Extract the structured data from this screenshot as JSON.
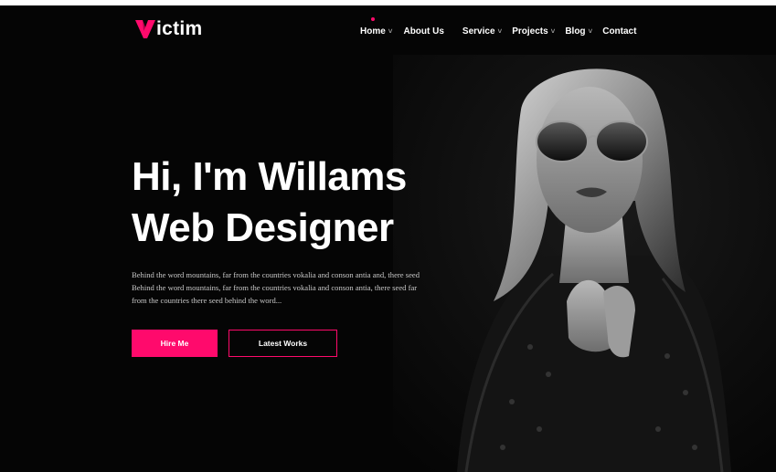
{
  "brand": {
    "logo_text": "ictim",
    "accent_color": "#ff0a6c"
  },
  "nav": {
    "items": [
      {
        "label": "Home",
        "caret": "˅"
      },
      {
        "label": "About Us",
        "caret": ""
      },
      {
        "label": "Service",
        "caret": "˅"
      },
      {
        "label": "Projects",
        "caret": "˅"
      },
      {
        "label": "Blog",
        "caret": "˅"
      },
      {
        "label": "Contact",
        "caret": ""
      }
    ]
  },
  "hero": {
    "title_line1": "Hi, I'm Willams",
    "title_line2": "Web Designer",
    "description": "Behind the word mountains, far from the countries vokalia and conson antia and, there seed Behind the word mountains, far from the countries vokalia and conson antia, there seed far from the countries there seed behind the word...",
    "primary_button": "Hire Me",
    "secondary_button": "Latest Works"
  }
}
